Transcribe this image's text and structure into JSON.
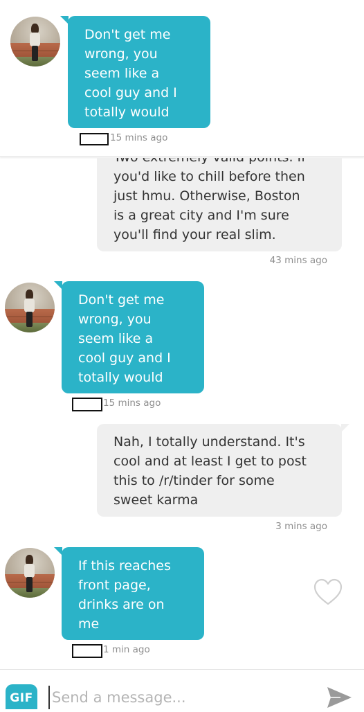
{
  "conversation": {
    "screenshot_one": {
      "received_message": {
        "lines": [
          "Don't get me",
          "wrong, you",
          "seem like a",
          "cool guy and I",
          "totally would"
        ],
        "timestamp": "15 mins ago"
      }
    },
    "screenshot_two": {
      "sent_message_1": {
        "lines": [
          "Two extremely valid points. If",
          "you'd like to chill before then",
          "just hmu. Otherwise, Boston",
          "is a great city and I'm sure",
          "you'll find your real slim."
        ],
        "timestamp": "43 mins ago"
      },
      "received_message_1": {
        "lines": [
          "Don't get me",
          "wrong, you",
          "seem like a",
          "cool guy and I",
          "totally would"
        ],
        "timestamp": "15 mins ago"
      },
      "sent_message_2": {
        "lines": [
          "Nah, I totally understand. It's",
          "cool and at least I get to post",
          "this to /r/tinder for some",
          "sweet karma"
        ],
        "timestamp": "3 mins ago"
      },
      "received_message_2": {
        "lines": [
          "If this reaches",
          "front page,",
          "drinks are on",
          "me"
        ],
        "timestamp": "1 min ago"
      }
    }
  },
  "composer": {
    "gif_label": "GIF",
    "placeholder": "Send a message...",
    "send_icon": "send-arrow-icon"
  },
  "icons": {
    "like": "heart-outline-icon",
    "redaction": "redaction-box"
  },
  "colors": {
    "received_bubble": "#2bb3c8",
    "sent_bubble": "#efefef",
    "timestamp": "#8e8e8e",
    "placeholder": "#b4b4b4",
    "icon_gray": "#9a9a9a"
  }
}
